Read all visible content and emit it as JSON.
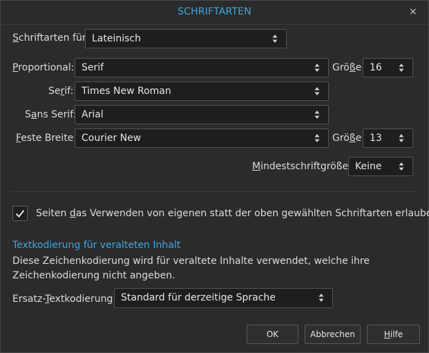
{
  "dialog": {
    "title": "SCHRIFTARTEN",
    "close_glyph": "×"
  },
  "fonts_for": {
    "label_u": "S",
    "label_rest": "chriftarten für:",
    "value": "Lateinisch"
  },
  "proportional": {
    "label_u": "P",
    "label_rest": "roportional:",
    "value": "Serif",
    "size_label_pre": "Grö",
    "size_label_u": "ß",
    "size_label_post": "e",
    "size_value": "16"
  },
  "serif": {
    "label_pre": "Se",
    "label_u": "r",
    "label_rest": "if:",
    "value": "Times New Roman"
  },
  "sans_serif": {
    "label_pre": "S",
    "label_u": "a",
    "label_rest": "ns Serif:",
    "value": "Arial"
  },
  "monospace": {
    "label_u": "F",
    "label_rest": "este Breite:",
    "value": "Courier New",
    "size_label_pre": "Grö",
    "size_label_u": "ß",
    "size_label_post": "e",
    "size_value": "13"
  },
  "min_size": {
    "label_u": "M",
    "label_rest": "indestschriftgröße:",
    "value": "Keine"
  },
  "allow_fonts": {
    "checked": true,
    "text_pre": "Seiten ",
    "text_u": "d",
    "text_post": "as Verwenden von eigenen statt der oben gewählten Schriftarten erlauben"
  },
  "encoding": {
    "heading": "Textkodierung für veralteten Inhalt",
    "line1": "Diese Zeichenkodierung wird für veraltete Inhalte verwendet, welche ihre",
    "line2": "Zeichenkodierung nicht angeben.",
    "label_pre": "Ersatz-",
    "label_u": "T",
    "label_rest": "extkodierung:",
    "value": "Standard für derzeitige Sprache"
  },
  "buttons": {
    "ok": "OK",
    "cancel": "Abbrechen",
    "help_u": "H",
    "help_rest": "ilfe"
  },
  "colors": {
    "accent": "#3fa7e0",
    "background": "#2b2b2b",
    "field": "#1e1e1e"
  },
  "icons": {
    "close": "close-icon",
    "select_arrows": "updown-arrows-icon",
    "check": "check-icon"
  }
}
